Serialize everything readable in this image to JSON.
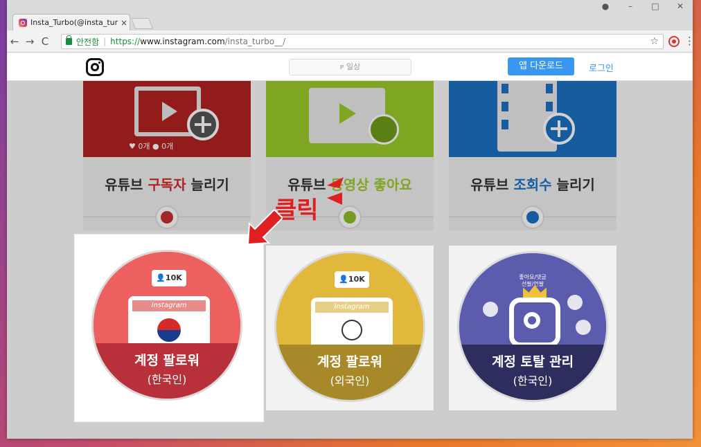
{
  "browser": {
    "tab_title": "Insta_Turbo(@insta_turb",
    "tab_close": "×",
    "secure_label": "안전함",
    "url_scheme": "https://",
    "url_host": "www.instagram.com",
    "url_path": "/insta_turbo__/",
    "win_profile": "●",
    "win_min": "–",
    "win_max": "□",
    "win_close": "✕",
    "back": "←",
    "forward": "→",
    "reload": "C",
    "star": "☆",
    "menu": "⋮"
  },
  "header": {
    "search_placeholder": "ᴘ 일상",
    "app_download": "앱 다운로드",
    "login": "로그인"
  },
  "cards": [
    {
      "prefix": "유튜브 ",
      "highlight": "구독자",
      "suffix": " 늘리기",
      "counters": "♥ 0개   ● 0개"
    },
    {
      "prefix": "유튜브 ",
      "highlight": "동영상 좋아요",
      "suffix": ""
    },
    {
      "prefix": "유튜브 ",
      "highlight": "조회수",
      "suffix": " 늘리기"
    }
  ],
  "panels": [
    {
      "badge": "👤10K",
      "app": "Instagram",
      "line1": "계정 팔로워",
      "line2": "(한국인)"
    },
    {
      "badge": "👤10K",
      "app": "Instagram",
      "line1": "계정 팔로워",
      "line2": "(외국인)"
    },
    {
      "top_text_1": "좋아요/댓글",
      "top_text_2": "선팔/언팔",
      "line1": "계정 토탈 관리",
      "line2": "(한국인)"
    }
  ],
  "annotation": {
    "click": "클릭"
  },
  "colors": {
    "ig_blue": "#3897f0",
    "red": "#b32222",
    "green": "#9ccb2a",
    "blue": "#1a72c2",
    "panel_red": "#e85a5a",
    "panel_yellow": "#e2b83c",
    "panel_purple": "#5a5aa8"
  }
}
